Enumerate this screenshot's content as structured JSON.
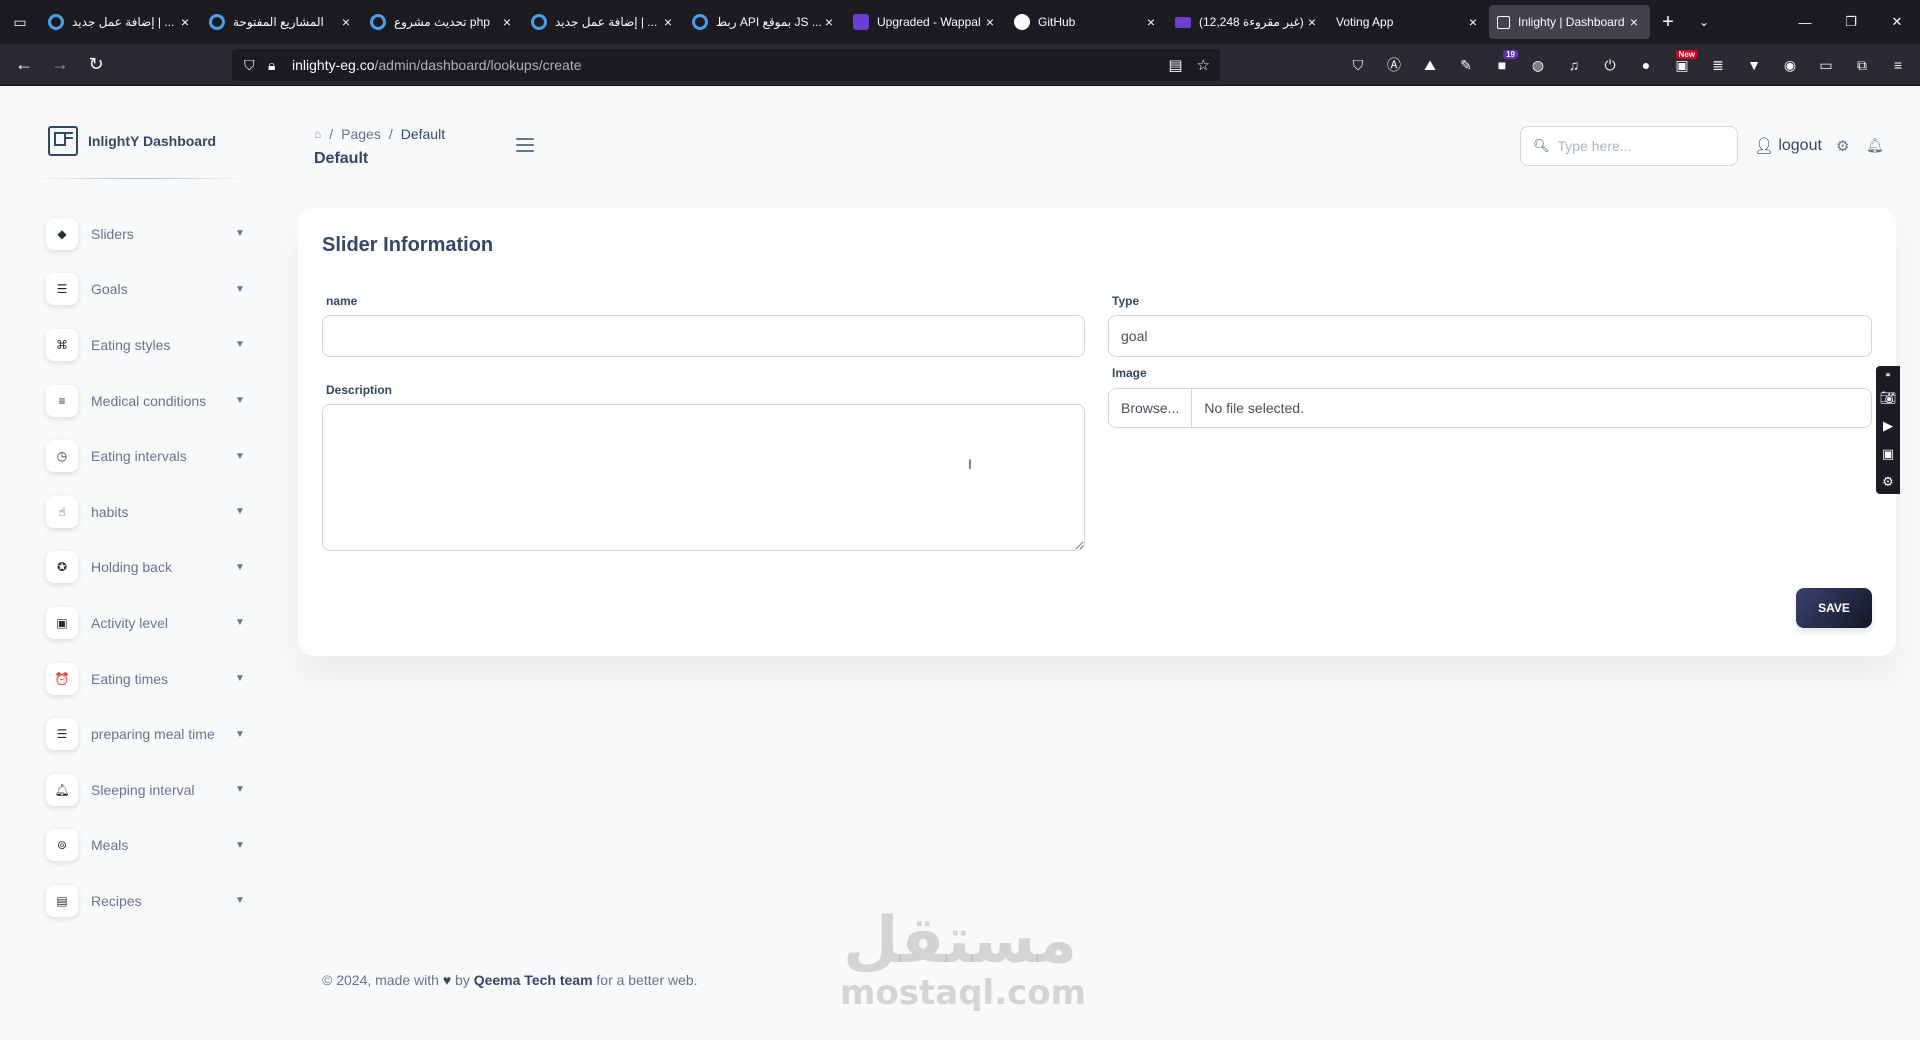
{
  "browser": {
    "tabs": [
      {
        "title": "إضافة عمل جديد | ...",
        "favicon": "circle-blue-icon"
      },
      {
        "title": "المشاريع المفتوحة",
        "favicon": "circle-blue-icon"
      },
      {
        "title": "تحديث مشروع php",
        "favicon": "circle-blue-icon"
      },
      {
        "title": "إضافة عمل جديد | ...",
        "favicon": "circle-blue-icon"
      },
      {
        "title": "ربط API بموقع JS ...",
        "favicon": "circle-blue-icon"
      },
      {
        "title": "Upgraded - Wappal",
        "favicon": "hexagon-purple-icon"
      },
      {
        "title": "GitHub",
        "favicon": "github-icon"
      },
      {
        "title": "(12,248 غير مقروءة)",
        "favicon": "mail-purple-icon"
      },
      {
        "title": "Voting App",
        "favicon": "none"
      },
      {
        "title": "Inlighty | Dashboard",
        "favicon": "page-icon"
      }
    ],
    "url_host": "inlighty-eg.co",
    "url_path": "/admin/dashboard/lookups/create",
    "ext_badge_count": "19",
    "ext_badge_new": "New"
  },
  "sidebar": {
    "brand": "InlightY Dashboard",
    "items": [
      {
        "label": "Sliders",
        "icon": "cube-icon"
      },
      {
        "label": "Goals",
        "icon": "list-icon"
      },
      {
        "label": "Eating styles",
        "icon": "grid-icon"
      },
      {
        "label": "Medical conditions",
        "icon": "align-center-icon"
      },
      {
        "label": "Eating intervals",
        "icon": "clock-icon"
      },
      {
        "label": "habits",
        "icon": "hand-icon"
      },
      {
        "label": "Holding back",
        "icon": "life-ring-icon"
      },
      {
        "label": "Activity level",
        "icon": "briefcase-icon"
      },
      {
        "label": "Eating times",
        "icon": "alarm-icon"
      },
      {
        "label": "preparing meal time",
        "icon": "list-icon"
      },
      {
        "label": "Sleeping interval",
        "icon": "bell-icon"
      },
      {
        "label": "Meals",
        "icon": "utensils-icon"
      },
      {
        "label": "Recipes",
        "icon": "book-icon"
      }
    ]
  },
  "topnav": {
    "crumb_pages": "Pages",
    "crumb_current": "Default",
    "page_title": "Default",
    "search_placeholder": "Type here...",
    "logout_label": "logout"
  },
  "form": {
    "title": "Slider Information",
    "name_label": "name",
    "name_value": "",
    "description_label": "Description",
    "type_label": "Type",
    "type_value": "goal",
    "image_label": "Image",
    "browse_label": "Browse...",
    "file_status": "No file selected.",
    "save_label": "SAVE"
  },
  "footer": {
    "prefix": "© 2024, made with",
    "by": "by",
    "team": "Qeema Tech team",
    "suffix": "for a better web."
  },
  "watermark": {
    "arabic": "مستقل",
    "latin": "mostaql.com"
  },
  "colors": {
    "primary_text": "#344767",
    "secondary_text": "#67748e",
    "save_button": "#3a416f"
  }
}
